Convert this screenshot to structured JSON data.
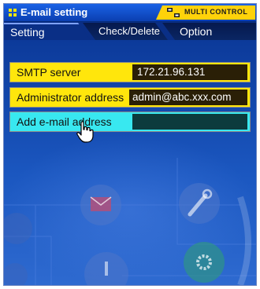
{
  "window": {
    "title": "E-mail setting",
    "badge": "MULTI CONTROL"
  },
  "tabs": [
    {
      "label": "Setting",
      "active": true
    },
    {
      "label": "Check/Delete",
      "active": false
    },
    {
      "label": "Option",
      "active": false
    }
  ],
  "form": {
    "smtp_label": "SMTP server",
    "smtp_value": "172.21.96.131",
    "admin_label": "Administrator address",
    "admin_value": "admin@abc.xxx.com",
    "add_label": "Add e-mail address",
    "add_value": ""
  },
  "icons": {
    "title": "grid-dots-icon",
    "badge": "multi-control-icon",
    "cursor": "hand-pointer-icon",
    "background": [
      "mail-icon",
      "wrench-icon",
      "gear-icon",
      "warning-icon"
    ]
  },
  "colors": {
    "window_bg": "#0a2f86",
    "row_yellow": "#ffe60c",
    "row_cyan": "#38e8f0",
    "value_bg": "#2a1f06",
    "badge": "#ffd20a"
  }
}
